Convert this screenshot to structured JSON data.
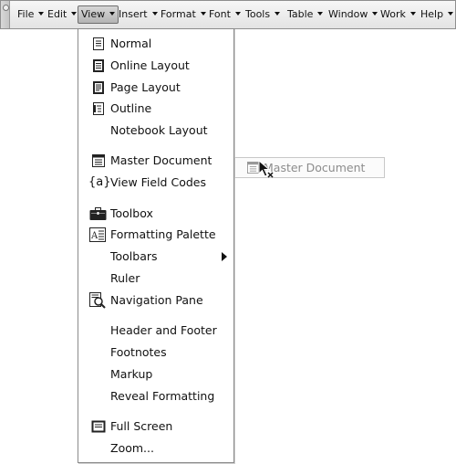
{
  "menubar": {
    "items": [
      {
        "label": "File"
      },
      {
        "label": "Edit"
      },
      {
        "label": "View"
      },
      {
        "label": "Insert"
      },
      {
        "label": "Format"
      },
      {
        "label": "Font"
      },
      {
        "label": "Tools"
      },
      {
        "label": "Table"
      },
      {
        "label": "Window"
      },
      {
        "label": "Work"
      },
      {
        "label": "Help"
      }
    ],
    "active": "View"
  },
  "view_menu": {
    "items": [
      {
        "label": "Normal",
        "icon": "normal-view-icon"
      },
      {
        "label": "Online Layout",
        "icon": "online-layout-icon"
      },
      {
        "label": "Page Layout",
        "icon": "page-layout-icon"
      },
      {
        "label": "Outline",
        "icon": "outline-icon"
      },
      {
        "label": "Notebook Layout"
      },
      {
        "label": "Master Document",
        "icon": "master-document-icon"
      },
      {
        "label": "View Field Codes",
        "icon": "field-codes-icon",
        "icon_text": "{a}"
      },
      {
        "label": "Toolbox",
        "icon": "toolbox-icon"
      },
      {
        "label": "Formatting Palette",
        "icon": "formatting-palette-icon"
      },
      {
        "label": "Toolbars",
        "submenu": true
      },
      {
        "label": "Ruler"
      },
      {
        "label": "Navigation Pane",
        "icon": "navigation-pane-icon"
      },
      {
        "label": "Header and Footer"
      },
      {
        "label": "Footnotes"
      },
      {
        "label": "Markup"
      },
      {
        "label": "Reveal Formatting"
      },
      {
        "label": "Full Screen",
        "icon": "full-screen-icon"
      },
      {
        "label": "Zoom..."
      }
    ]
  },
  "drag_ghost": {
    "label": "Master Document",
    "icon": "master-document-icon"
  }
}
